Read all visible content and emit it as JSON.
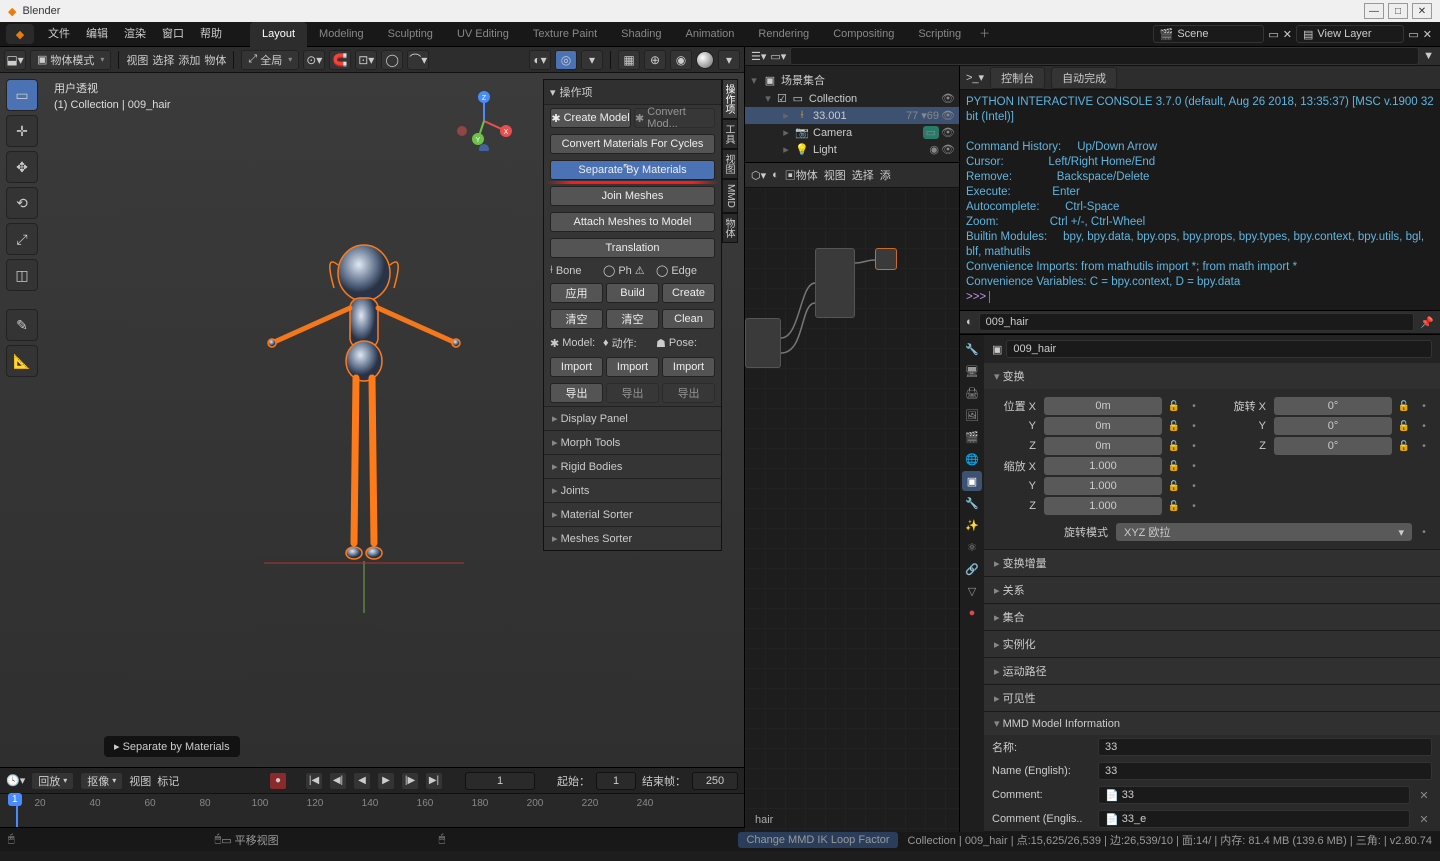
{
  "app_title": "Blender",
  "window_buttons": {
    "min": "—",
    "max": "□",
    "close": "✕"
  },
  "top_menus": [
    "文件",
    "编辑",
    "渲染",
    "窗口",
    "帮助"
  ],
  "workspaces": [
    "Layout",
    "Modeling",
    "Sculpting",
    "UV Editing",
    "Texture Paint",
    "Shading",
    "Animation",
    "Rendering",
    "Compositing",
    "Scripting"
  ],
  "active_workspace": "Layout",
  "scene_label": "Scene",
  "viewlayer_label": "View Layer",
  "toolrow": {
    "mode": "物体模式",
    "menus": [
      "视图",
      "选择",
      "添加",
      "物体"
    ],
    "orient": "全局"
  },
  "viewport": {
    "line1": "用户透视",
    "line2": "(1) Collection | 009_hair",
    "hint": "▸  Separate by Materials"
  },
  "npanels": {
    "tabs": [
      "操作项",
      "工具",
      "视图",
      "MMD",
      "物体"
    ],
    "header": "操作项",
    "create_model": "Create Model",
    "convert_model": "Convert Mod...",
    "convert_cycles": "Convert Materials For Cycles",
    "separate": "Separate By Materials",
    "join": "Join Meshes",
    "attach": "Attach Meshes to Model",
    "translation": "Translation",
    "bone": "Bone",
    "ph": "Ph",
    "edge": "Edge",
    "apply": "应用",
    "build": "Build",
    "create": "Create",
    "clear1": "清空",
    "clear2": "清空",
    "clean": "Clean",
    "model": "Model:",
    "action": "动作:",
    "pose": "Pose:",
    "import": "Import",
    "export": "导出",
    "panels": [
      "Display Panel",
      "Morph Tools",
      "Rigid Bodies",
      "Joints",
      "Material Sorter",
      "Meshes Sorter"
    ]
  },
  "timeline": {
    "menus": [
      "回放",
      "抠像",
      "视图",
      "标记"
    ],
    "start_label": "起始：",
    "start": "1",
    "end_label": "结束帧：",
    "end": "250",
    "current": "1",
    "ticks": [
      "20",
      "40",
      "60",
      "80",
      "100",
      "120",
      "140",
      "160",
      "180",
      "200",
      "220",
      "240"
    ]
  },
  "outliner": {
    "scene": "场景集合",
    "collection": "Collection",
    "items": [
      {
        "icon": "👤",
        "label": "33.001",
        "sel": true,
        "extra": "77 ▾69"
      },
      {
        "icon": "📷",
        "label": "Camera"
      },
      {
        "icon": "💡",
        "label": "Light"
      }
    ]
  },
  "console": {
    "tab1": "控制台",
    "tab2": "自动完成",
    "body": "PYTHON INTERACTIVE CONSOLE 3.7.0 (default, Aug 26 2018, 13:35:37) [MSC v.1900 32 bit (Intel)]\n\nCommand History:     Up/Down Arrow\nCursor:              Left/Right Home/End\nRemove:              Backspace/Delete\nExecute:             Enter\nAutocomplete:        Ctrl-Space\nZoom:                Ctrl +/-, Ctrl-Wheel\nBuiltin Modules:     bpy, bpy.data, bpy.ops, bpy.props, bpy.types, bpy.context, bpy.utils, bgl, blf, mathutils\nConvenience Imports: from mathutils import *; from math import *\nConvenience Variables: C = bpy.context, D = bpy.data\n",
    "prompt": ">>> "
  },
  "nodeeditor": {
    "mode": "物体",
    "menus": [
      "视图",
      "选择",
      "添"
    ],
    "material": "009_hair",
    "label": "hair"
  },
  "properties": {
    "object_name": "009_hair",
    "transform": "变换",
    "loc": "位置",
    "rot": "旋转",
    "scale": "缩放",
    "locX": "0m",
    "locY": "0m",
    "locZ": "0m",
    "rotX": "0°",
    "rotY": "0°",
    "rotZ": "0°",
    "sclX": "1.000",
    "sclY": "1.000",
    "sclZ": "1.000",
    "rotmode_label": "旋转模式",
    "rotmode": "XYZ 欧拉",
    "delta": "变换增量",
    "panels": [
      "关系",
      "集合",
      "实例化",
      "运动路径",
      "可见性"
    ],
    "mmd_header": "MMD Model Information",
    "mmd": {
      "name_l": "名称:",
      "name_v": "33",
      "nameE_l": "Name (English):",
      "nameE_v": "33",
      "comment_l": "Comment:",
      "comment_v": "33",
      "commentE_l": "Comment (Englis..",
      "commentE_v": "33_e"
    }
  },
  "status": {
    "left_icons": [
      "◧",
      "▭  平移视图",
      "▭"
    ],
    "hint": "Change MMD IK Loop Factor",
    "right": "Collection | 009_hair | 点:15,625/26,539 | 边:26,539/10 | 面:14/ | 内存: 81.4 MB (139.6 MB) | 三角: | v2.80.74"
  }
}
